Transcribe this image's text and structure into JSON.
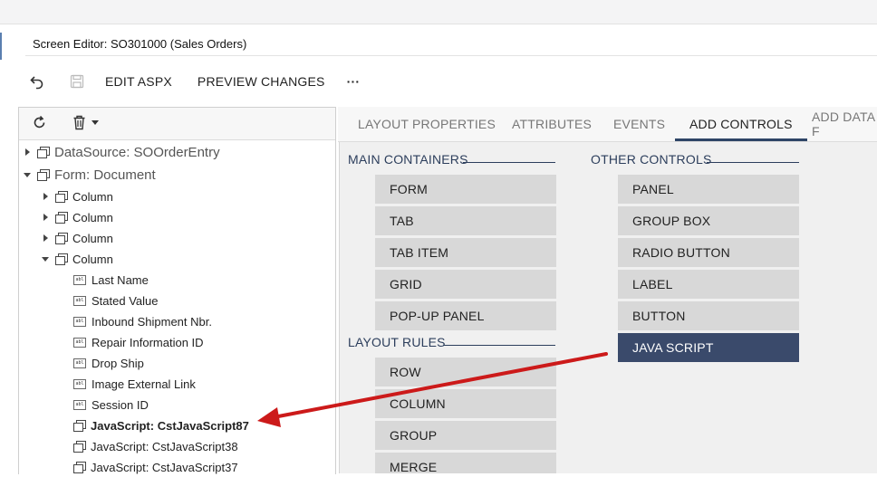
{
  "header": {
    "title": "Screen Editor: SO301000 (Sales Orders)"
  },
  "toolbar": {
    "undo_icon": "undo-icon",
    "save_icon": "save-icon",
    "edit_aspx": "EDIT ASPX",
    "preview_changes": "PREVIEW CHANGES",
    "more": "···"
  },
  "tree_toolbar": {
    "refresh_icon": "refresh-icon",
    "delete_icon": "trash-icon",
    "dropdown_icon": "caret-down-icon"
  },
  "tree": {
    "datasource": "DataSource: SOOrderEntry",
    "form": "Form: Document",
    "column1": "Column",
    "column2": "Column",
    "column3": "Column",
    "column4": "Column",
    "field1": "Last Name",
    "field2": "Stated Value",
    "field3": "Inbound Shipment Nbr.",
    "field4": "Repair Information ID",
    "field5": "Drop Ship",
    "field6": "Image External Link",
    "field7": "Session ID",
    "js1": "JavaScript: CstJavaScript87",
    "js2": "JavaScript: CstJavaScript38",
    "js3": "JavaScript: CstJavaScript37"
  },
  "tabs": {
    "layout_properties": "LAYOUT PROPERTIES",
    "attributes": "ATTRIBUTES",
    "events": "EVENTS",
    "add_controls": "ADD CONTROLS",
    "add_data_fields": "ADD DATA F"
  },
  "controls": {
    "main_containers": "MAIN CONTAINERS",
    "form": "FORM",
    "tab": "TAB",
    "tab_item": "TAB ITEM",
    "grid": "GRID",
    "popup_panel": "POP-UP PANEL",
    "layout_rules": "LAYOUT RULES",
    "row": "ROW",
    "column": "COLUMN",
    "group": "GROUP",
    "merge": "MERGE",
    "other_controls": "OTHER CONTROLS",
    "panel": "PANEL",
    "group_box": "GROUP BOX",
    "radio_button": "RADIO BUTTON",
    "label": "LABEL",
    "button": "BUTTON",
    "java_script": "JAVA SCRIPT"
  },
  "colors": {
    "accent": "#2f4567",
    "selected_button": "#3a4a6b",
    "annotation_arrow": "#cc1a1a"
  }
}
